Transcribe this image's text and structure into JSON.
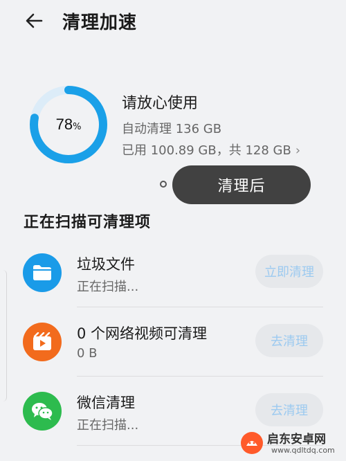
{
  "header": {
    "title": "清理加速"
  },
  "storage": {
    "percent": 78,
    "percent_value": "78",
    "percent_unit": "%",
    "status": "请放心使用",
    "auto_clean": "自动清理 136 GB",
    "usage": "已用 100.89 GB，共 128 GB",
    "after_label": "清理后",
    "ring_color": "#1aa0e8",
    "ring_track_color": "#dcecf8"
  },
  "scan": {
    "section_title": "正在扫描可清理项",
    "items": [
      {
        "icon": "folder-icon",
        "title": "垃圾文件",
        "subtitle": "正在扫描...",
        "button": "立即清理",
        "icon_color": "#1a9be8"
      },
      {
        "icon": "video-play-icon",
        "title": "0 个网络视频可清理",
        "subtitle": "0 B",
        "button": "去清理",
        "icon_color": "#f26b1d"
      },
      {
        "icon": "wechat-icon",
        "title": "微信清理",
        "subtitle": "正在扫描...",
        "button": "去清理",
        "icon_color": "#2dbb4e"
      }
    ]
  },
  "watermark": {
    "name": "启东安卓网",
    "url": "www.qdltdq.com"
  }
}
